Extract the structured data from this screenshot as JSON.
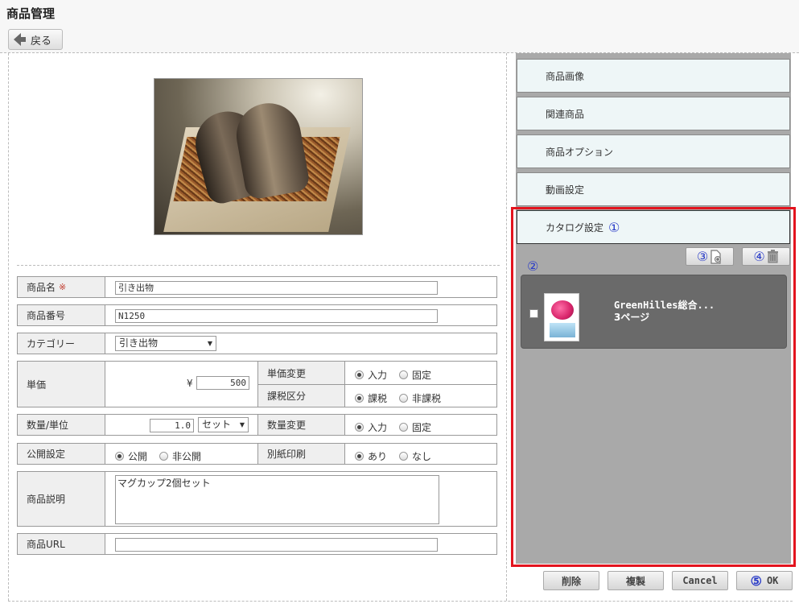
{
  "header": {
    "title": "商品管理",
    "back_label": "戻る"
  },
  "form": {
    "name_label": "商品名",
    "required_mark": "※",
    "name_value": "引き出物",
    "number_label": "商品番号",
    "number_value": "N1250",
    "category_label": "カテゴリー",
    "category_value": "引き出物",
    "price_label": "単価",
    "currency": "¥",
    "price_value": "500",
    "price_change_label": "単価変更",
    "price_change_options": [
      "入力",
      "固定"
    ],
    "tax_label": "課税区分",
    "tax_options": [
      "課税",
      "非課税"
    ],
    "qty_label": "数量/単位",
    "qty_value": "1.0",
    "unit_value": "セット",
    "qty_change_label": "数量変更",
    "qty_change_options": [
      "入力",
      "固定"
    ],
    "public_label": "公開設定",
    "public_options": [
      "公開",
      "非公開"
    ],
    "print_label": "別紙印刷",
    "print_options": [
      "あり",
      "なし"
    ],
    "desc_label": "商品説明",
    "desc_value": "マグカップ2個セット",
    "url_label": "商品URL",
    "url_value": ""
  },
  "side_tabs": [
    "商品画像",
    "関連商品",
    "商品オプション",
    "動画設定",
    "カタログ設定"
  ],
  "markers": [
    "①",
    "②",
    "③",
    "④",
    "⑤"
  ],
  "catalog": {
    "title": "GreenHilles総合...",
    "pages": "3ページ"
  },
  "actions": {
    "delete": "削除",
    "duplicate": "複製",
    "cancel": "Cancel",
    "ok": "OK"
  }
}
